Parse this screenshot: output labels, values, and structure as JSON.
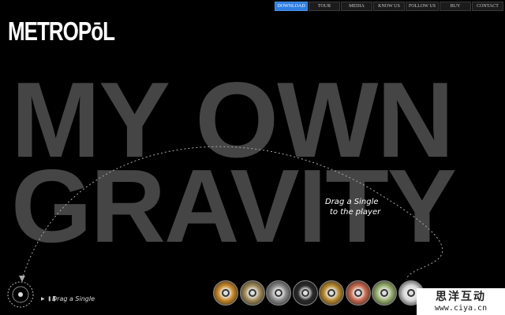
{
  "logo": {
    "text": "METROPōL"
  },
  "nav": [
    {
      "label": "DOWNLOAD",
      "active": true
    },
    {
      "label": "TOUR",
      "active": false
    },
    {
      "label": "MEDIA",
      "active": false
    },
    {
      "label": "KNOW US",
      "active": false
    },
    {
      "label": "FOLLOW US",
      "active": false
    },
    {
      "label": "BUY",
      "active": false
    },
    {
      "label": "CONTACT",
      "active": false
    }
  ],
  "hero": {
    "line1": "MY OWN",
    "line2": "GRAVITY"
  },
  "hint": {
    "line1": "Drag a Single",
    "line2": "to the player"
  },
  "player": {
    "controls": "▶ ❚❚",
    "label": "Drag a Single",
    "icon": "vinyl-record-icon"
  },
  "singles": [
    {
      "name": "single-1",
      "color": "#c8892a"
    },
    {
      "name": "single-2",
      "color": "#a08a5a"
    },
    {
      "name": "single-3",
      "color": "#8a8a8a"
    },
    {
      "name": "single-4",
      "color": "#2a2a2a"
    },
    {
      "name": "single-5",
      "color": "#b88a30"
    },
    {
      "name": "single-6",
      "color": "#c86a50"
    },
    {
      "name": "single-7",
      "color": "#9ab070"
    },
    {
      "name": "single-8",
      "color": "#d8d8d8"
    }
  ],
  "watermark": {
    "line1": "思洋互动",
    "line2": "www.ciya.cn"
  }
}
